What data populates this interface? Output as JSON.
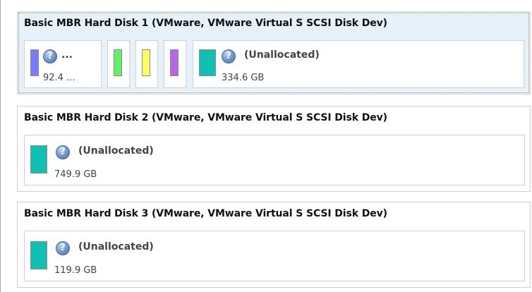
{
  "disks": [
    {
      "title": "Basic MBR Hard Disk 1 (VMware, VMware Virtual S SCSI Disk Dev)",
      "partitions": [
        {
          "label": "...",
          "size": "92.4 ...",
          "color": "#7b7bff"
        },
        {
          "color": "#66ee66"
        },
        {
          "color": "#ffff66"
        },
        {
          "color": "#b667e6"
        },
        {
          "label": "(Unallocated)",
          "size": "334.6 GB",
          "color": "#12bfb3"
        }
      ]
    },
    {
      "title": "Basic MBR Hard Disk 2 (VMware, VMware Virtual S SCSI Disk Dev)",
      "partitions": [
        {
          "label": "(Unallocated)",
          "size": "749.9 GB",
          "color": "#12bfb3"
        }
      ]
    },
    {
      "title": "Basic MBR Hard Disk 3 (VMware, VMware Virtual S SCSI Disk Dev)",
      "partitions": [
        {
          "label": "(Unallocated)",
          "size": "119.9 GB",
          "color": "#12bfb3"
        }
      ]
    }
  ],
  "icons": {
    "partition_status": "help-question-icon",
    "help_glyph": "?"
  }
}
